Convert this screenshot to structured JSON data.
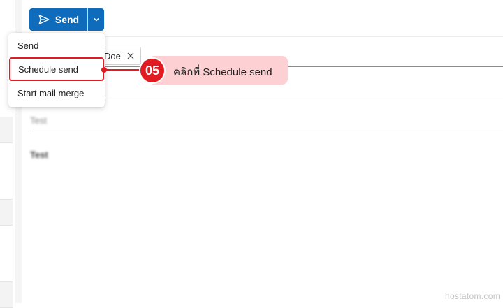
{
  "toolbar": {
    "send_label": "Send"
  },
  "send_menu": {
    "items": [
      {
        "label": "Send"
      },
      {
        "label": "Schedule send"
      },
      {
        "label": "Start mail merge"
      }
    ]
  },
  "recipient": {
    "chip_label": "Doe"
  },
  "compose": {
    "subject_blurred": "Test",
    "body_blurred": "Test"
  },
  "annotation": {
    "step": "05",
    "instruction": "คลิกที่ Schedule send",
    "accent_color": "#e01b22",
    "callout_color": "#fdd0d3"
  },
  "watermark": "hostatom.com",
  "colors": {
    "send_button": "#0f6cbd"
  }
}
